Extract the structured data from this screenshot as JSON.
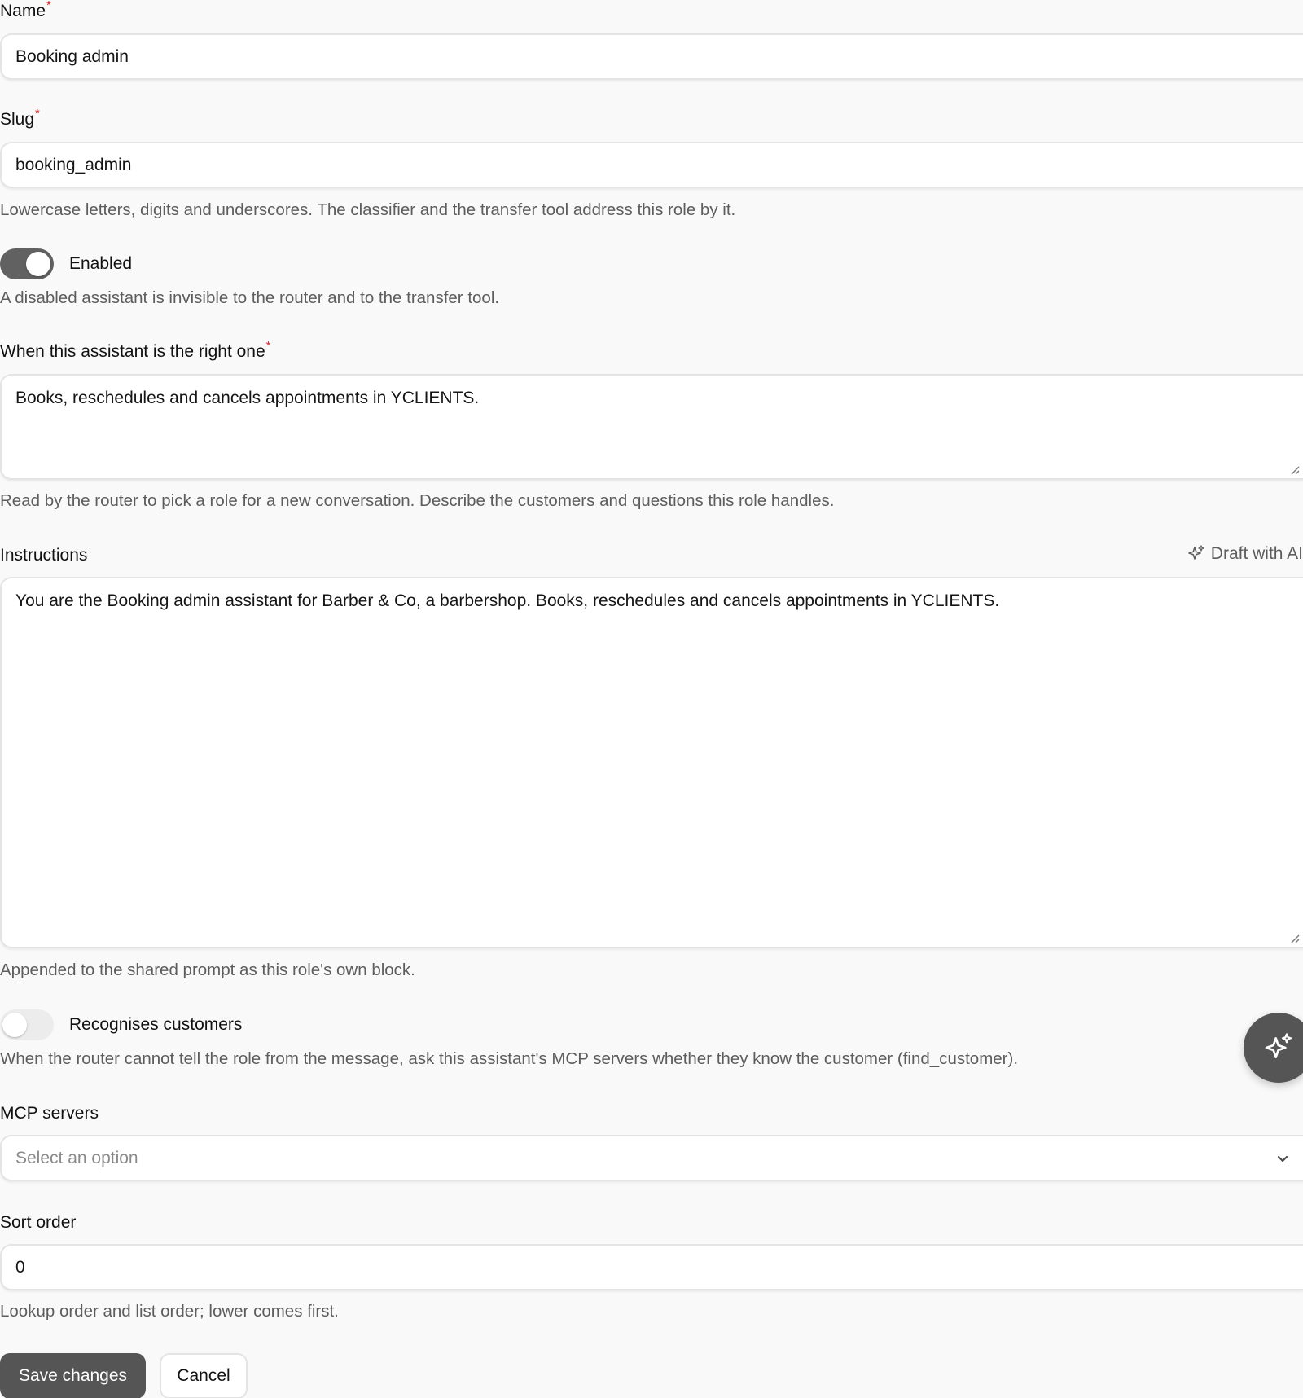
{
  "form": {
    "name": {
      "label": "Name",
      "required_mark": "*",
      "value": "Booking admin"
    },
    "slug": {
      "label": "Slug",
      "required_mark": "*",
      "value": "booking_admin",
      "help": "Lowercase letters, digits and underscores. The classifier and the transfer tool address this role by it."
    },
    "enabled": {
      "label": "Enabled",
      "checked": true,
      "help": "A disabled assistant is invisible to the router and to the transfer tool."
    },
    "when_right_one": {
      "label": "When this assistant is the right one",
      "required_mark": "*",
      "value": "Books, reschedules and cancels appointments in YCLIENTS.",
      "help": "Read by the router to pick a role for a new conversation. Describe the customers and questions this role handles."
    },
    "instructions": {
      "label": "Instructions",
      "draft_ai_label": "Draft with AI",
      "draft_ai_icon": "sparkle-icon",
      "value": "You are the Booking admin assistant for Barber & Co, a barbershop. Books, reschedules and cancels appointments in YCLIENTS.",
      "help": "Appended to the shared prompt as this role's own block."
    },
    "recognises_customers": {
      "label": "Recognises customers",
      "checked": false,
      "help": "When the router cannot tell the role from the message, ask this assistant's MCP servers whether they know the customer (find_customer)."
    },
    "mcp_servers": {
      "label": "MCP servers",
      "placeholder": "Select an option",
      "icon": "chevron-down-icon"
    },
    "sort_order": {
      "label": "Sort order",
      "value": "0",
      "help": "Lookup order and list order; lower comes first."
    }
  },
  "actions": {
    "save_label": "Save changes",
    "cancel_label": "Cancel"
  },
  "fab": {
    "icon": "sparkle-icon"
  },
  "colors": {
    "required": "#dc2626",
    "primary_button": "#555555",
    "toggle_on": "#616161",
    "toggle_off": "#ececec",
    "background": "#f9f9f9"
  }
}
